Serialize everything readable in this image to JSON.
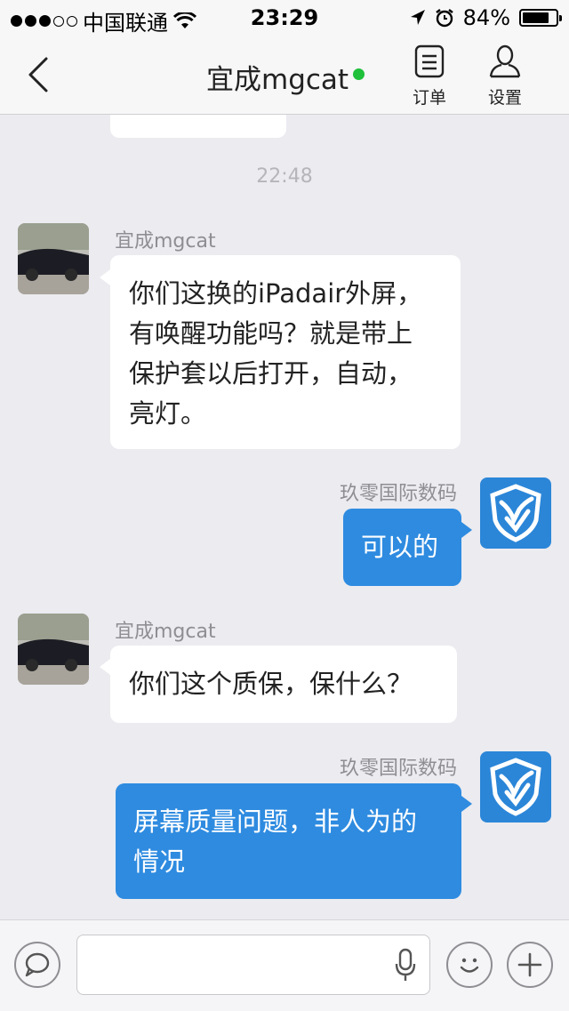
{
  "status_bar": {
    "carrier": "中国联通",
    "time": "23:29",
    "battery": "84%",
    "battery_level": 0.84
  },
  "header": {
    "title": "宜成mgcat",
    "online_color": "#1fc03a",
    "orders_label": "订单",
    "settings_label": "设置"
  },
  "chat": {
    "timestamp": "22:48",
    "messages": [
      {
        "sender": "宜成mgcat",
        "side": "in",
        "lines": [
          "你们这换的iPadair外屏，",
          "有唤醒功能吗？就是带上",
          "保护套以后打开，自动，",
          "亮灯。"
        ]
      },
      {
        "sender": "玖零国际数码",
        "side": "out",
        "lines": [
          "可以的"
        ]
      },
      {
        "sender": "宜成mgcat",
        "side": "in",
        "lines": [
          "你们这个质保，保什么？"
        ]
      },
      {
        "sender": "玖零国际数码",
        "side": "out",
        "lines": [
          "屏幕质量问题，非人为的",
          "情况"
        ]
      }
    ]
  },
  "input_bar": {
    "placeholder": "",
    "icons": [
      "chat-bubble-icon",
      "microphone-icon",
      "emoji-icon",
      "plus-icon"
    ]
  },
  "colors": {
    "outgoing_bubble": "#2e8be0",
    "incoming_bubble": "#ffffff",
    "background": "#ebebf0"
  }
}
